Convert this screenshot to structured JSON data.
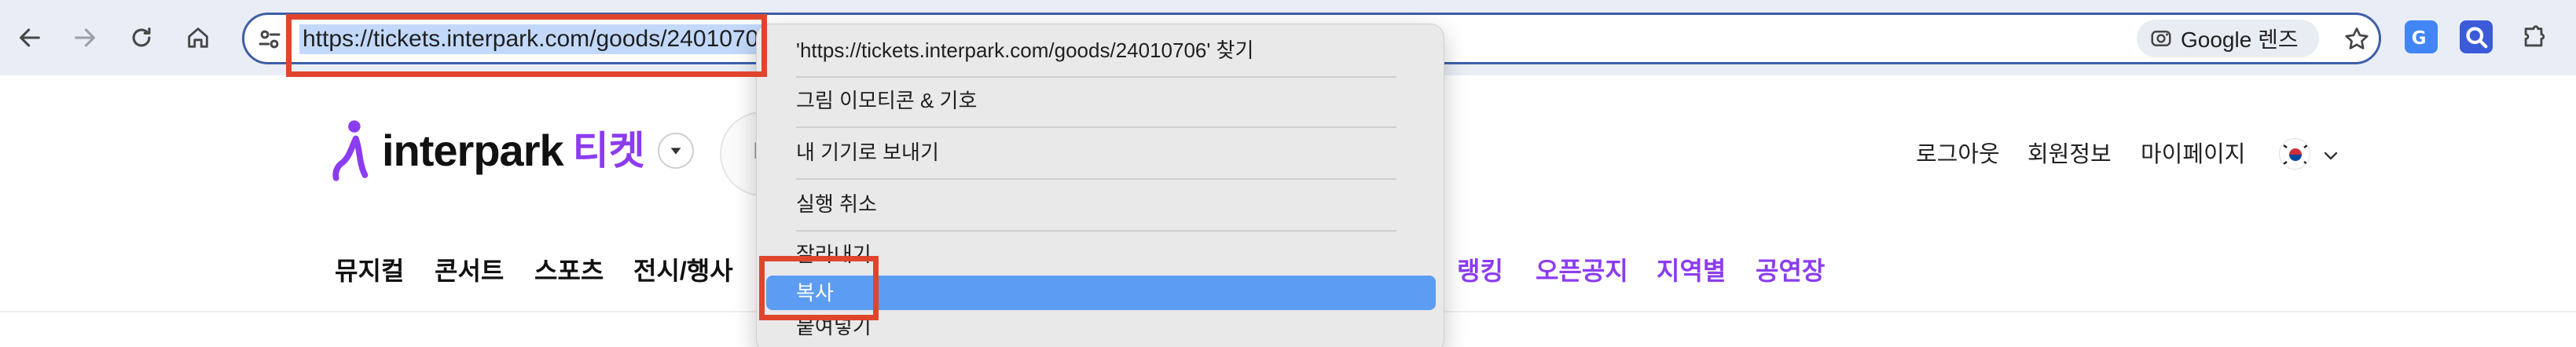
{
  "browser": {
    "url": "https://tickets.interpark.com/goods/24010706",
    "lens_label": "Google 렌즈",
    "accent": "#3f5ea8",
    "highlight_color": "#e0452c",
    "icons": [
      "back-icon",
      "forward-icon",
      "reload-icon",
      "home-icon",
      "site-info-icon",
      "lens-icon",
      "star-icon",
      "extension-icon",
      "puzzle-icon"
    ]
  },
  "header": {
    "logo_text": "interpark",
    "logo_ticket": "티켓",
    "search_placeholder": "L",
    "util_links": [
      "로그아웃",
      "회원정보",
      "마이페이지"
    ]
  },
  "nav": {
    "left": [
      "뮤지컬",
      "콘서트",
      "스포츠",
      "전시/행사"
    ],
    "right": [
      "랭킹",
      "오픈공지",
      "지역별",
      "공연장"
    ],
    "brand_color": "#8c3cf0"
  },
  "context_menu": {
    "items": [
      "'https://tickets.interpark.com/goods/24010706' 찾기",
      "그림 이모티콘 & 기호",
      "내 기기로 보내기",
      "실행 취소",
      "잘라내기",
      "복사",
      "붙여넣기"
    ],
    "selected_index": 5,
    "selected_color": "#5c9cf2"
  }
}
